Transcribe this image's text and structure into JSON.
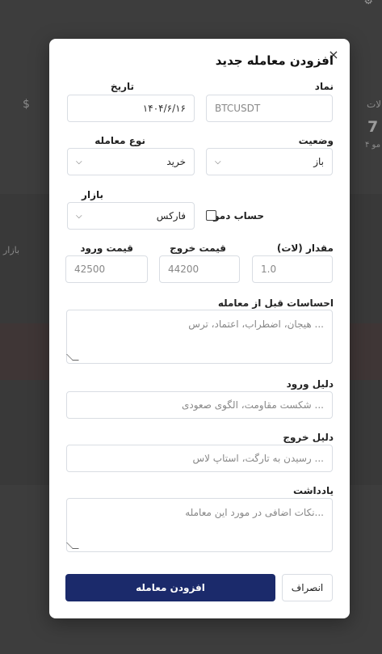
{
  "modal": {
    "title": "افزودن معامله جدید",
    "close_label": "×"
  },
  "form": {
    "symbol": {
      "label": "نماد",
      "value": "BTCUSDT"
    },
    "date": {
      "label": "تاریخ",
      "value": "۱۴۰۴/۶/۱۶"
    },
    "status": {
      "label": "وضعیت",
      "value": "باز"
    },
    "trade_type": {
      "label": "نوع معامله",
      "value": "خرید"
    },
    "market": {
      "label": "بازار",
      "value": "فارکس"
    },
    "demo_account": {
      "label": "حساب دمو",
      "checked": false
    },
    "quantity": {
      "label": "مقدار (لات)",
      "value": "1.0"
    },
    "exit_price": {
      "label": "قیمت خروج",
      "value": "44200"
    },
    "entry_price": {
      "label": "قیمت ورود",
      "value": "42500"
    },
    "feelings": {
      "label": "احساسات قبل از معامله",
      "placeholder": "... هیجان، اضطراب، اعتماد، ترس"
    },
    "entry_reason": {
      "label": "دلیل ورود",
      "placeholder": "... شکست مقاومت، الگوی صعودی"
    },
    "exit_reason": {
      "label": "دلیل خروج",
      "placeholder": "... رسیدن به تارگت، استاپ لاس"
    },
    "note": {
      "label": "یادداشت",
      "placeholder": "...نکات اضافی در مورد این معامله"
    }
  },
  "actions": {
    "submit_label": "افزودن معامله",
    "cancel_label": "انصراف"
  },
  "background": {
    "dollar": "$",
    "market_label": "بازار",
    "right_label": "لات",
    "right_number": "7",
    "right_small": "مو ۴"
  },
  "colors": {
    "primary": "#1b2a6b",
    "overlay": "#3d3d3d"
  }
}
